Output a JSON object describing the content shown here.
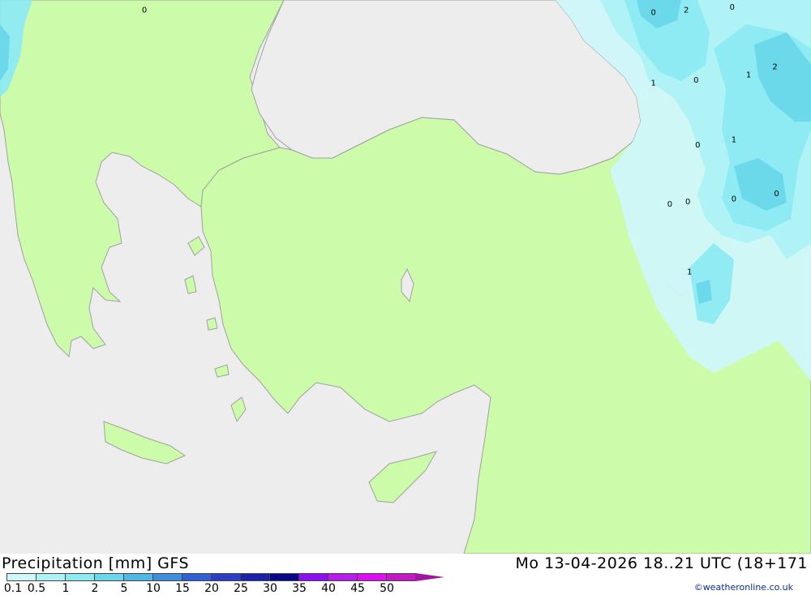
{
  "header": {
    "title": "Precipitation [mm] GFS",
    "valid_time": "Mo 13-04-2026 18..21 UTC (18+171"
  },
  "legend": {
    "ticks": [
      "0.1",
      "0.5",
      "1",
      "2",
      "5",
      "10",
      "15",
      "20",
      "25",
      "30",
      "35",
      "40",
      "45",
      "50"
    ],
    "colors": [
      "#cff7fa",
      "#aef2f7",
      "#8deaf2",
      "#6ad8ea",
      "#4fb8e3",
      "#3d8fdb",
      "#3060d2",
      "#2a3fc2",
      "#1e22a8",
      "#0b0884",
      "#8a12f0",
      "#b51ee6",
      "#dc10ef",
      "#c21ac2",
      "#9e169e"
    ]
  },
  "credit": "©weatheronline.co.uk",
  "map_labels": [
    {
      "text": "0",
      "lon": 24.3,
      "lat": 43.5
    },
    {
      "text": "2",
      "lon": 40.8,
      "lat": 43.5
    },
    {
      "text": "0",
      "lon": 42.2,
      "lat": 43.55
    },
    {
      "text": "0",
      "lon": 39.8,
      "lat": 43.45
    },
    {
      "text": "1",
      "lon": 39.8,
      "lat": 42.15
    },
    {
      "text": "0",
      "lon": 41.1,
      "lat": 42.2
    },
    {
      "text": "1",
      "lon": 42.7,
      "lat": 42.3
    },
    {
      "text": "2",
      "lon": 43.5,
      "lat": 42.45
    },
    {
      "text": "0",
      "lon": 41.15,
      "lat": 41.0
    },
    {
      "text": "1",
      "lon": 42.25,
      "lat": 41.1
    },
    {
      "text": "0",
      "lon": 40.3,
      "lat": 39.9
    },
    {
      "text": "0",
      "lon": 40.85,
      "lat": 39.95
    },
    {
      "text": "0",
      "lon": 42.25,
      "lat": 40.0
    },
    {
      "text": "0",
      "lon": 43.55,
      "lat": 40.1
    },
    {
      "text": "1",
      "lon": 40.9,
      "lat": 38.65
    }
  ],
  "colors": {
    "sea": "#ededed",
    "land": "#ccfca9",
    "border": "#a0a0a0"
  }
}
